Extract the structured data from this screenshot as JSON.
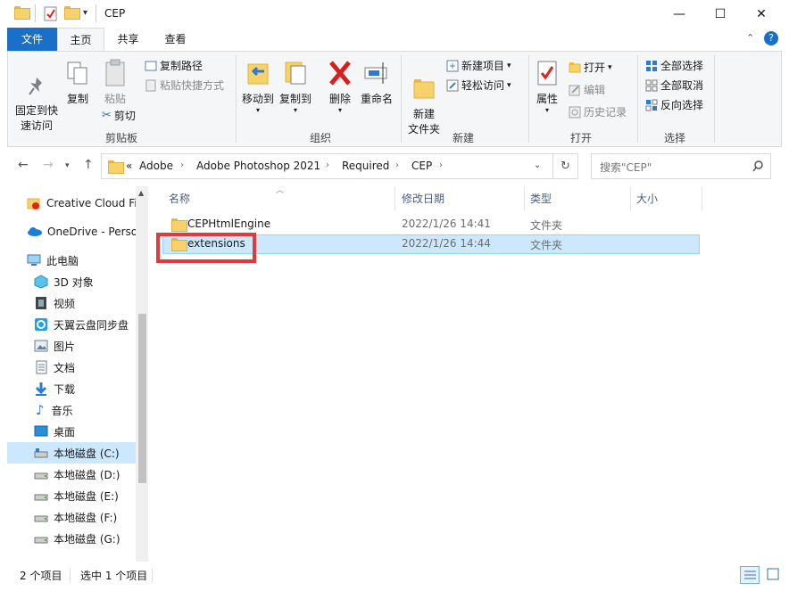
{
  "window": {
    "title": "CEP",
    "minimize": "—",
    "maximize": "☐",
    "close": "✕"
  },
  "tabs": [
    {
      "label": "文件"
    },
    {
      "label": "主页"
    },
    {
      "label": "共享"
    },
    {
      "label": "查看"
    }
  ],
  "ribbon": {
    "clipboard": {
      "pin": "固定到快\n速访问",
      "copy": "复制",
      "paste": "粘贴",
      "copy_path": "复制路径",
      "paste_shortcut": "粘贴快捷方式",
      "cut": "剪切",
      "group": "剪贴板"
    },
    "organize": {
      "move_to": "移动到",
      "copy_to": "复制到",
      "delete": "删除",
      "rename": "重命名",
      "group": "组织"
    },
    "new": {
      "new_folder": "新建\n文件夹",
      "new_item": "新建项目",
      "easy_access": "轻松访问",
      "group": "新建"
    },
    "open": {
      "properties": "属性",
      "open": "打开",
      "edit": "编辑",
      "history": "历史记录",
      "group": "打开"
    },
    "select": {
      "select_all": "全部选择",
      "select_none": "全部取消",
      "invert": "反向选择",
      "group": "选择"
    }
  },
  "address": {
    "overflow": "«",
    "crumbs": [
      "Adobe",
      "Adobe Photoshop 2021",
      "Required",
      "CEP"
    ],
    "search_placeholder": "搜索\"CEP\""
  },
  "navpane": {
    "items": [
      {
        "label": "Creative Cloud Fi",
        "icon": "creative-cloud-icon"
      },
      {
        "label": "OneDrive - Perso",
        "icon": "onedrive-icon"
      },
      {
        "label": "此电脑",
        "icon": "this-pc-icon"
      },
      {
        "label": "3D 对象",
        "icon": "3d-objects-icon"
      },
      {
        "label": "视频",
        "icon": "video-icon"
      },
      {
        "label": "天翼云盘同步盘",
        "icon": "cloud-sync-icon"
      },
      {
        "label": "图片",
        "icon": "pictures-icon"
      },
      {
        "label": "文档",
        "icon": "documents-icon"
      },
      {
        "label": "下载",
        "icon": "download-icon"
      },
      {
        "label": "音乐",
        "icon": "music-icon"
      },
      {
        "label": "桌面",
        "icon": "desktop-icon"
      },
      {
        "label": "本地磁盘 (C:)",
        "icon": "drive-icon"
      },
      {
        "label": "本地磁盘 (D:)",
        "icon": "drive-icon"
      },
      {
        "label": "本地磁盘 (E:)",
        "icon": "drive-icon"
      },
      {
        "label": "本地磁盘 (F:)",
        "icon": "drive-icon"
      },
      {
        "label": "本地磁盘 (G:)",
        "icon": "drive-icon"
      }
    ]
  },
  "filelist": {
    "columns": [
      "名称",
      "修改日期",
      "类型",
      "大小"
    ],
    "rows": [
      {
        "name": "CEPHtmlEngine",
        "date": "2022/1/26 14:41",
        "type": "文件夹",
        "size": ""
      },
      {
        "name": "extensions",
        "date": "2022/1/26 14:44",
        "type": "文件夹",
        "size": ""
      }
    ]
  },
  "status": {
    "count": "2 个项目",
    "selected": "选中 1 个项目"
  },
  "colors": {
    "file_tab": "#1a6fc9",
    "selection": "#cce8ff",
    "highlight_box": "#e13a3a",
    "folder": "#f7d26b"
  }
}
